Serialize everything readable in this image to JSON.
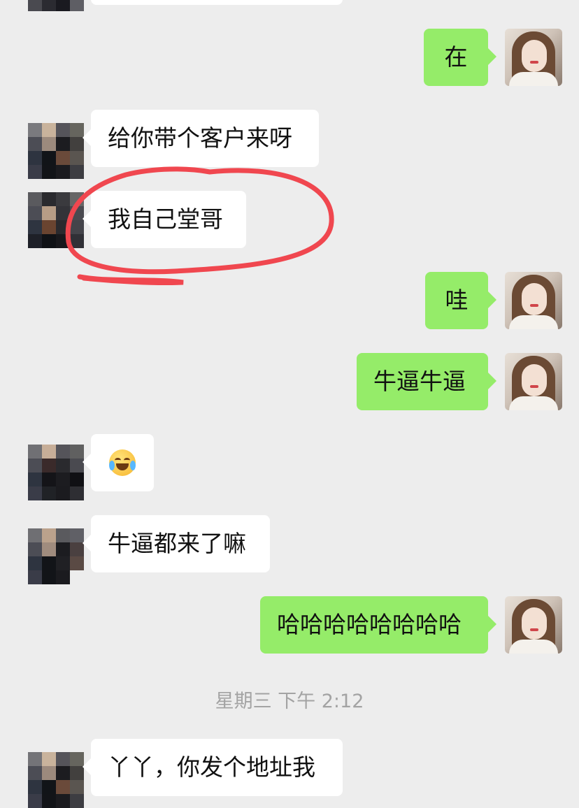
{
  "messages": [
    {
      "id": "m1",
      "side": "out",
      "text": "在"
    },
    {
      "id": "m2",
      "side": "in",
      "text": "给你带个客户来呀"
    },
    {
      "id": "m3",
      "side": "in",
      "text": "我自己堂哥"
    },
    {
      "id": "m4",
      "side": "out",
      "text": "哇"
    },
    {
      "id": "m5",
      "side": "out",
      "text": "牛逼牛逼"
    },
    {
      "id": "m6",
      "side": "in",
      "emoji": "laughing-crying-emoji"
    },
    {
      "id": "m7",
      "side": "in",
      "text": "牛逼都来了嘛"
    },
    {
      "id": "m8",
      "side": "out",
      "text": "哈哈哈哈哈哈哈哈"
    },
    {
      "id": "m9",
      "side": "in",
      "text": "丫丫，你发个地址我"
    }
  ],
  "timestamp": "星期三 下午 2:12",
  "colors": {
    "background": "#ededed",
    "incoming_bubble": "#ffffff",
    "outgoing_bubble": "#95ec69",
    "annotation_circle": "#f0474f"
  }
}
